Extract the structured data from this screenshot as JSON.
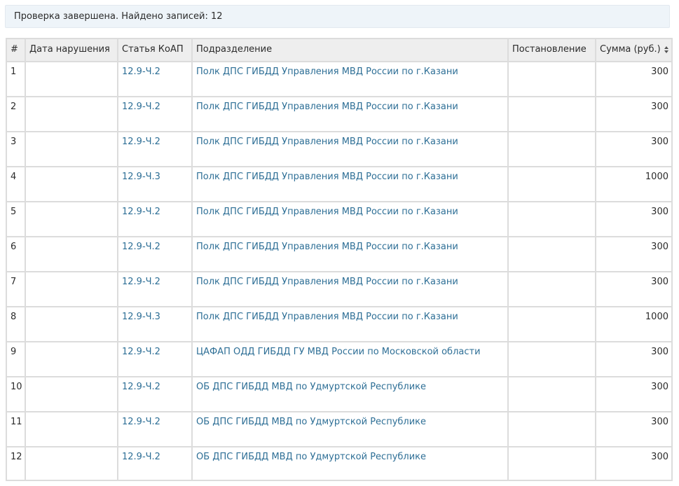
{
  "status": {
    "message": "Проверка завершена. Найдено записей: 12"
  },
  "table": {
    "headers": {
      "num": "#",
      "date": "Дата нарушения",
      "article": "Статья КоАП",
      "department": "Подразделение",
      "decree": "Постановление",
      "sum": "Сумма (руб.)"
    },
    "rows": [
      {
        "num": "1",
        "article": "12.9-Ч.2",
        "department": "Полк ДПС ГИБДД Управления МВД России по г.Казани",
        "sum": "300"
      },
      {
        "num": "2",
        "article": "12.9-Ч.2",
        "department": "Полк ДПС ГИБДД Управления МВД России по г.Казани",
        "sum": "300"
      },
      {
        "num": "3",
        "article": "12.9-Ч.2",
        "department": "Полк ДПС ГИБДД Управления МВД России по г.Казани",
        "sum": "300"
      },
      {
        "num": "4",
        "article": "12.9-Ч.3",
        "department": "Полк ДПС ГИБДД Управления МВД России по г.Казани",
        "sum": "1000"
      },
      {
        "num": "5",
        "article": "12.9-Ч.2",
        "department": "Полк ДПС ГИБДД Управления МВД России по г.Казани",
        "sum": "300"
      },
      {
        "num": "6",
        "article": "12.9-Ч.2",
        "department": "Полк ДПС ГИБДД Управления МВД России по г.Казани",
        "sum": "300"
      },
      {
        "num": "7",
        "article": "12.9-Ч.2",
        "department": "Полк ДПС ГИБДД Управления МВД России по г.Казани",
        "sum": "300"
      },
      {
        "num": "8",
        "article": "12.9-Ч.3",
        "department": "Полк ДПС ГИБДД Управления МВД России по г.Казани",
        "sum": "1000"
      },
      {
        "num": "9",
        "article": "12.9-Ч.2",
        "department": "ЦАФАП ОДД ГИБДД ГУ МВД России по Московской области",
        "sum": "300"
      },
      {
        "num": "10",
        "article": "12.9-Ч.2",
        "department": "ОБ ДПС ГИБДД МВД по Удмуртской Республике",
        "sum": "300"
      },
      {
        "num": "11",
        "article": "12.9-Ч.2",
        "department": "ОБ ДПС ГИБДД МВД по Удмуртской Республике",
        "sum": "300"
      },
      {
        "num": "12",
        "article": "12.9-Ч.2",
        "department": "ОБ ДПС ГИБДД МВД по Удмуртской Республике",
        "sum": "300"
      }
    ]
  },
  "colors": {
    "link": "#2e6f96",
    "status_bg": "#eef4f9",
    "header_bg": "#eeeeee",
    "border": "#dcdcdc"
  },
  "icons": {
    "sum_sort": "sort-arrows-icon"
  }
}
